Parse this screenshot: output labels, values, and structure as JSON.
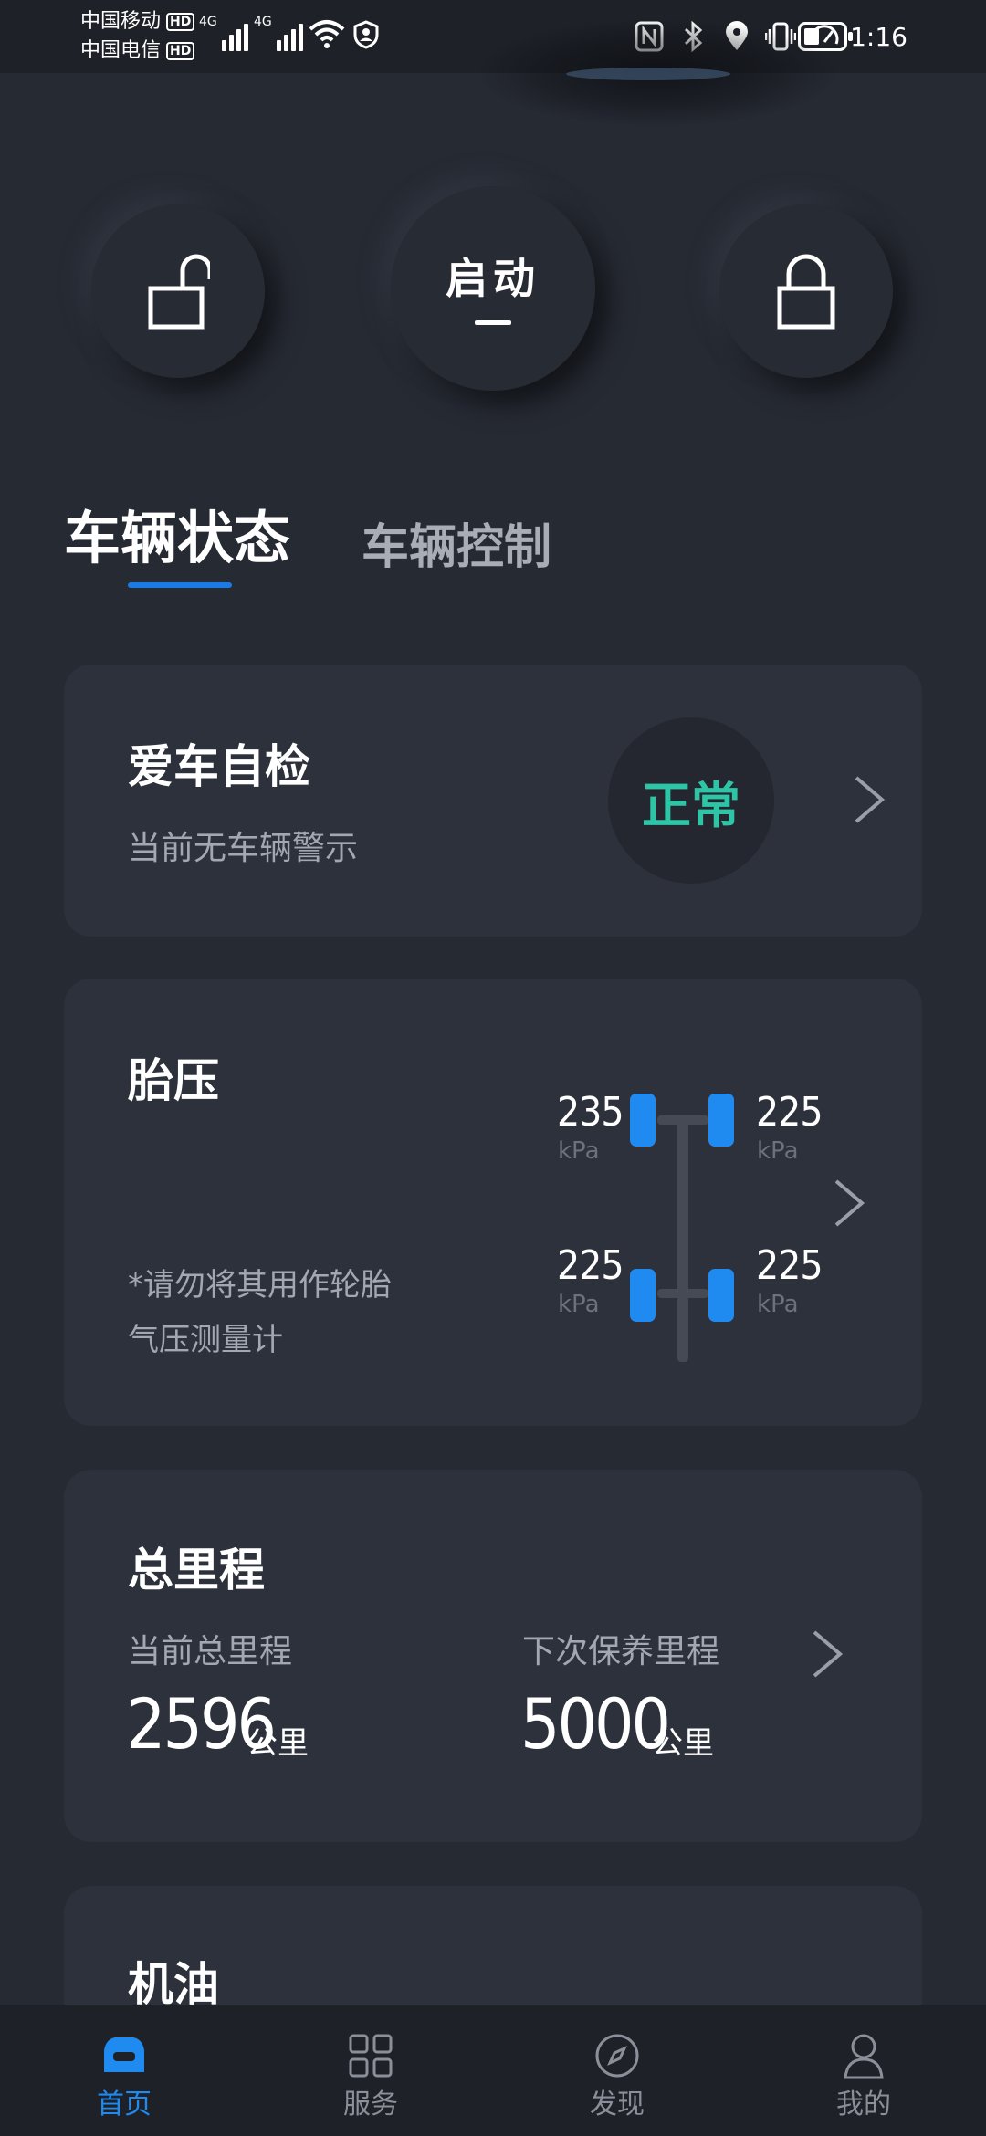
{
  "status_bar": {
    "carrier1": "中国移动",
    "carrier2": "中国电信",
    "hd_badge": "HD",
    "net1": "4G",
    "net2": "4G",
    "time": "1:16"
  },
  "controls": {
    "unlock_icon": "unlock-icon",
    "start_label": "启动",
    "lock_icon": "lock-icon"
  },
  "tabs": [
    {
      "label": "车辆状态",
      "active": true
    },
    {
      "label": "车辆控制",
      "active": false
    }
  ],
  "self_check": {
    "title": "爱车自检",
    "subtitle": "当前无车辆警示",
    "status": "正常",
    "status_color": "#2ec4a6"
  },
  "tire_pressure": {
    "title": "胎压",
    "note_line1": "*请勿将其用作轮胎",
    "note_line2": "气压测量计",
    "unit": "kPa",
    "front_left": "235",
    "front_right": "225",
    "rear_left": "225",
    "rear_right": "225",
    "wheel_color": "#1f8bf0"
  },
  "mileage": {
    "title": "总里程",
    "current_label": "当前总里程",
    "current_value": "2596",
    "next_label": "下次保养里程",
    "next_value": "5000",
    "unit": "公里"
  },
  "oil": {
    "title": "机油"
  },
  "bottom_nav": [
    {
      "label": "首页",
      "icon": "car-home-icon",
      "active": true
    },
    {
      "label": "服务",
      "icon": "grid-icon",
      "active": false
    },
    {
      "label": "发现",
      "icon": "compass-icon",
      "active": false
    },
    {
      "label": "我的",
      "icon": "person-icon",
      "active": false
    }
  ],
  "accent_color": "#1a7be6"
}
